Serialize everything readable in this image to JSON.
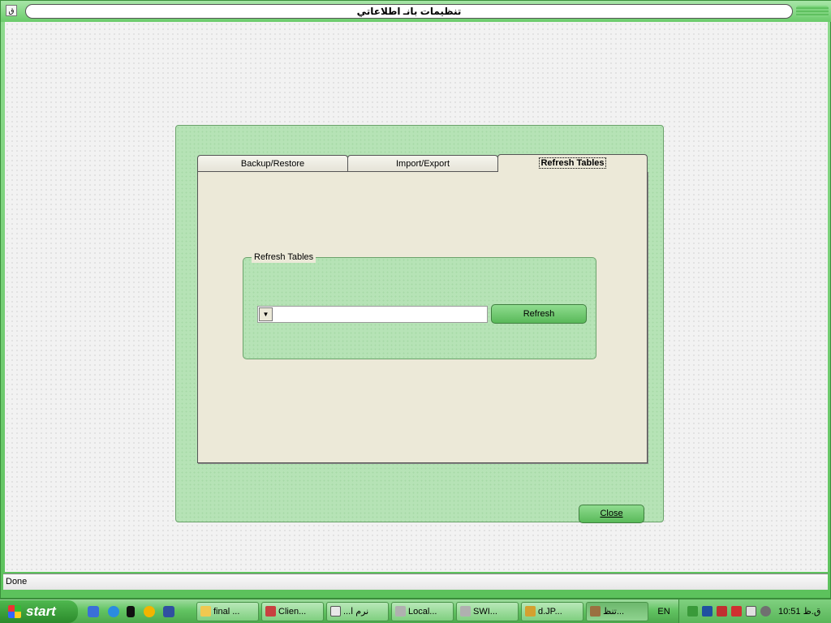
{
  "window": {
    "title": "تنظيمات بانـ اطلاعاتي",
    "sys_icon_glyph": "ق"
  },
  "dialog": {
    "tabs": [
      {
        "label": "Backup/Restore",
        "active": false
      },
      {
        "label": "Import/Export",
        "active": false
      },
      {
        "label": "Refresh Tables",
        "active": true
      }
    ],
    "group_title": "Refresh Tables",
    "combo_value": "",
    "refresh_button": "Refresh",
    "close_button": "Close"
  },
  "status_text": "Done",
  "taskbar": {
    "start_label": "start",
    "quick_launch": [
      "outlook-icon",
      "ie-icon",
      "terminal-icon",
      "media-player-icon",
      "xdesktop-icon"
    ],
    "tasks": [
      {
        "label": "final ...",
        "icon": "folder-icon"
      },
      {
        "label": "Clien...",
        "icon": "app-icon"
      },
      {
        "label": "...نرم ا",
        "icon": "window-icon"
      },
      {
        "label": "Local...",
        "icon": "drive-icon"
      },
      {
        "label": "SWI...",
        "icon": "drive-icon"
      },
      {
        "label": "d.JP...",
        "icon": "image-icon"
      },
      {
        "label": "تنظ...",
        "icon": "app-icon",
        "active": true
      }
    ],
    "language": "EN",
    "clock": "10:51 ق.ظ"
  },
  "colors": {
    "accent": "#6fcf6f",
    "panel": "#ece9d8",
    "dialog": "#b6e3b6"
  }
}
